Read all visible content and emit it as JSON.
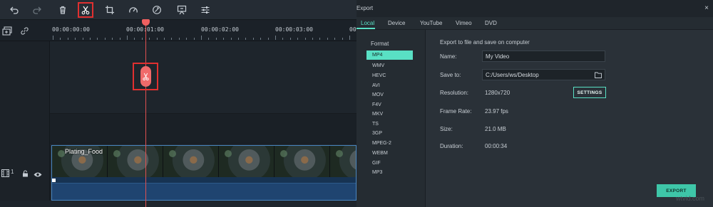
{
  "toolbar": {
    "icons": [
      "undo-icon",
      "redo-icon",
      "delete-icon",
      "split-icon",
      "crop-icon",
      "speed-icon",
      "color-icon",
      "green-screen-icon",
      "adjust-icon"
    ]
  },
  "timeline": {
    "timecodes": [
      "00:00:00:00",
      "00:00:01:00",
      "00:00:02:00",
      "00:00:03:00",
      "00"
    ],
    "video_track_number": "1",
    "clip_label": "Plating_Food"
  },
  "dialog": {
    "title": "Export",
    "close": "×",
    "tabs": [
      "Local",
      "Device",
      "YouTube",
      "Vimeo",
      "DVD"
    ],
    "active_tab": "Local",
    "format_heading": "Format",
    "formats": [
      "MP4",
      "WMV",
      "HEVC",
      "AVI",
      "MOV",
      "F4V",
      "MKV",
      "TS",
      "3GP",
      "MPEG-2",
      "WEBM",
      "GIF",
      "MP3"
    ],
    "selected_format": "MP4",
    "panel_heading": "Export to file and save on computer",
    "name_label": "Name:",
    "name_value": "My Video",
    "save_label": "Save to:",
    "save_value": "C:/Users/ws/Desktop",
    "resolution_label": "Resolution:",
    "resolution_value": "1280x720",
    "settings_button": "SETTINGS",
    "framerate_label": "Frame Rate:",
    "framerate_value": "23.97 fps",
    "size_label": "Size:",
    "size_value": "21.0 MB",
    "duration_label": "Duration:",
    "duration_value": "00:00:34",
    "export_button": "EXPORT"
  },
  "watermark": "wtvid.com",
  "colors": {
    "accent": "#59e0c4",
    "highlight": "#e03030",
    "playhead": "#f06060"
  }
}
